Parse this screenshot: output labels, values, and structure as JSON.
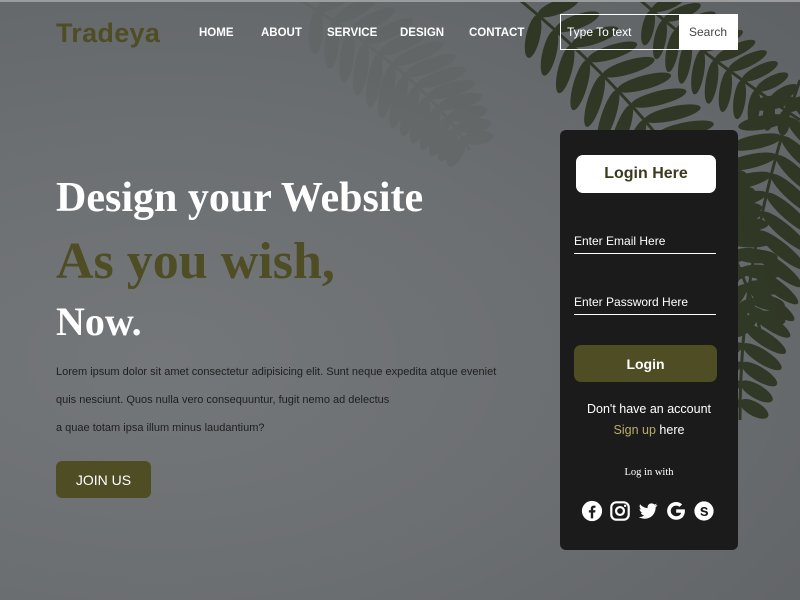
{
  "brand": {
    "logo": "Tradeya"
  },
  "nav": {
    "items": [
      {
        "label": "HOME"
      },
      {
        "label": "ABOUT"
      },
      {
        "label": "SERVICE"
      },
      {
        "label": "DESIGN"
      },
      {
        "label": "CONTACT"
      }
    ]
  },
  "search": {
    "placeholder": "Type To text",
    "button_label": "Search"
  },
  "hero": {
    "line1": "Design your Website",
    "line2": "As you wish,",
    "line3": "Now.",
    "paragraph": [
      "Lorem ipsum dolor sit amet consectetur adipisicing elit. Sunt neque expedita atque eveniet",
      "quis nesciunt. Quos nulla vero consequuntur, fugit nemo ad delectus",
      "a quae totam ipsa illum minus laudantium?"
    ],
    "cta_label": "JOIN US"
  },
  "login": {
    "title": "Login Here",
    "email_placeholder": "Enter Email Here",
    "password_placeholder": "Enter Password Here",
    "button_label": "Login",
    "no_account_text": "Don't have an account",
    "signup_link": "Sign up",
    "signup_suffix": " here",
    "login_with": "Log in with",
    "social_icons": [
      "facebook-icon",
      "instagram-icon",
      "twitter-icon",
      "google-icon",
      "skype-icon"
    ]
  },
  "colors": {
    "accent": "#4f4d24",
    "card_bg": "#1b1b1b",
    "background": "#6e7174",
    "link": "#b8ad6a"
  }
}
